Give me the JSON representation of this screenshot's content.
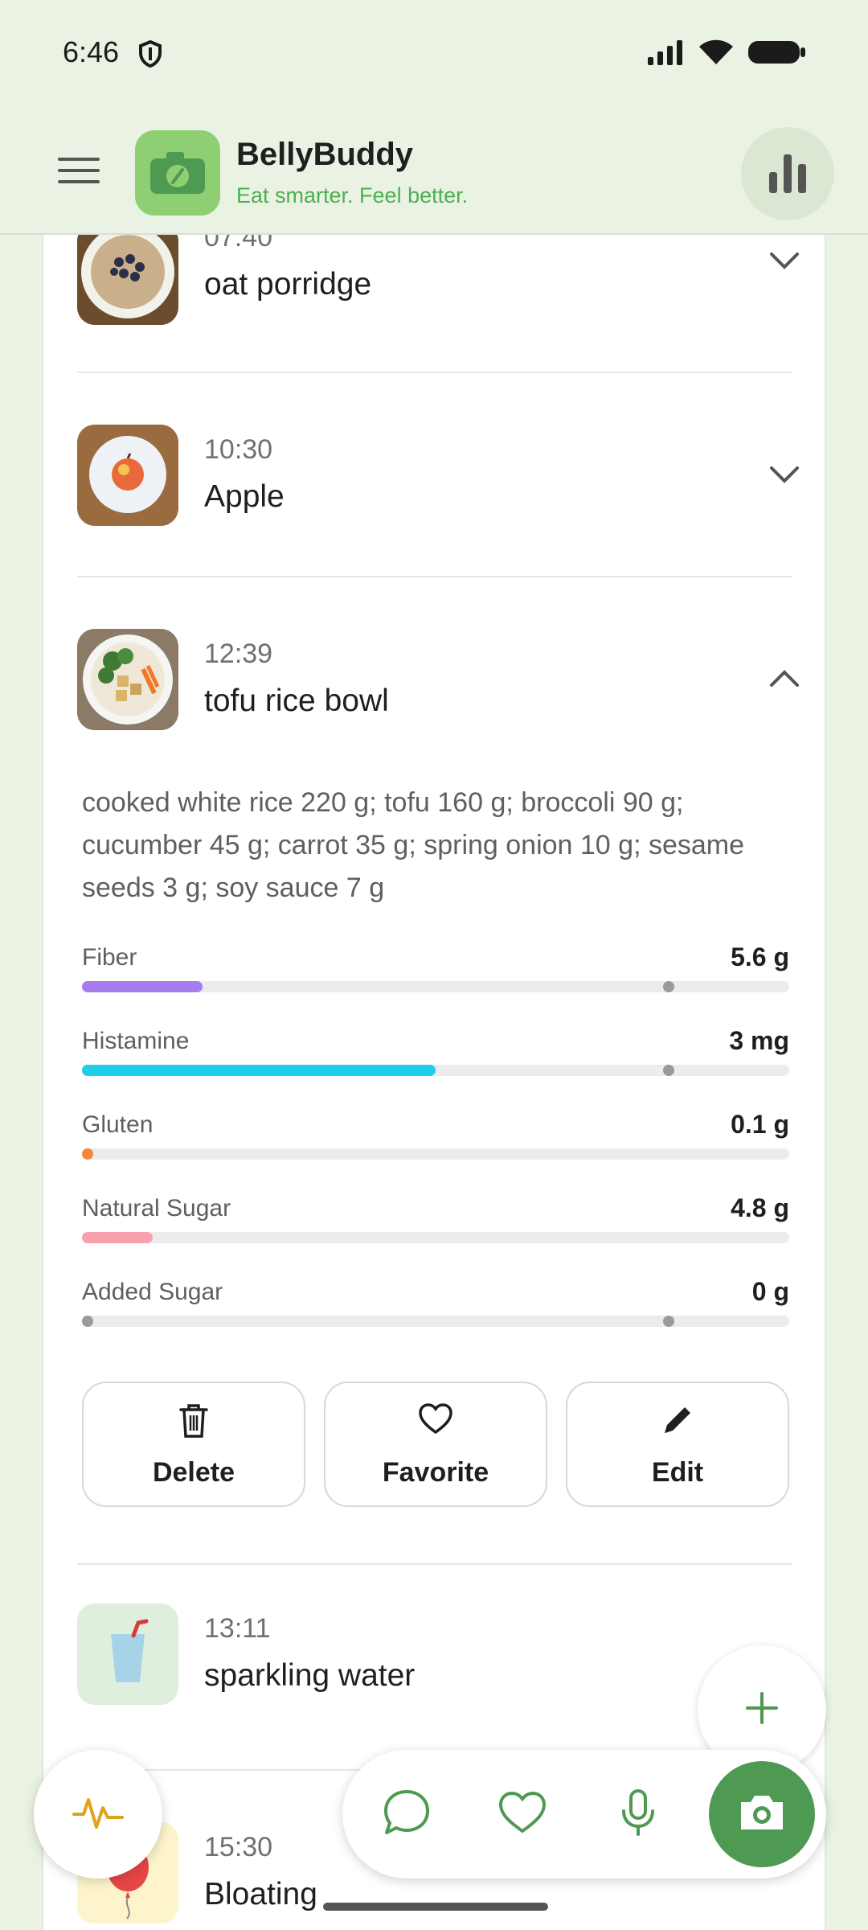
{
  "status_bar": {
    "time": "6:46"
  },
  "app": {
    "title": "BellyBuddy",
    "subtitle": "Eat smarter. Feel better."
  },
  "meals": [
    {
      "time": "07:40",
      "name": "oat porridge",
      "thumb_icon": "oat-porridge-photo",
      "expanded": false
    },
    {
      "time": "10:30",
      "name": "Apple",
      "thumb_icon": "apple-photo",
      "expanded": false
    },
    {
      "time": "12:39",
      "name": "tofu rice bowl",
      "thumb_icon": "tofu-rice-bowl-photo",
      "expanded": true,
      "description": "cooked white rice 220 g; tofu 160 g; broccoli 90 g; cucumber 45 g; carrot 35 g; spring onion 10 g; sesame seeds 3 g; soy sauce 7 g"
    },
    {
      "time": "13:11",
      "name": "sparkling water",
      "thumb_icon": "glass-with-straw-icon",
      "expanded": false
    },
    {
      "time": "15:30",
      "name": "Bloating",
      "thumb_icon": "balloon-icon",
      "expanded": false
    }
  ],
  "nutrients": [
    {
      "label": "Fiber",
      "value": "5.6 g",
      "color": "#a77cf0",
      "fill_fraction": 0.17,
      "marker_fraction": 0.83
    },
    {
      "label": "Histamine",
      "value": "3 mg",
      "color": "#22cde8",
      "fill_fraction": 0.5,
      "marker_fraction": 0.83
    },
    {
      "label": "Gluten",
      "value": "0.1 g",
      "color": "#f2893a",
      "fill_fraction": 0.0,
      "marker_fraction": null
    },
    {
      "label": "Natural Sugar",
      "value": "4.8 g",
      "color": "#f7a1ae",
      "fill_fraction": 0.1,
      "marker_fraction": null
    },
    {
      "label": "Added Sugar",
      "value": "0 g",
      "color": "#9a9a9a",
      "fill_fraction": 0.0,
      "marker_fraction": 0.83
    }
  ],
  "actions": {
    "delete": "Delete",
    "favorite": "Favorite",
    "edit": "Edit"
  },
  "colors": {
    "brand_green": "#4e9a52",
    "subtitle_green": "#4caf50",
    "background": "#eaf3e3"
  },
  "nav_icons": [
    "pulse-icon",
    "chat-icon",
    "heart-icon",
    "microphone-icon",
    "camera-icon",
    "plus-icon"
  ]
}
